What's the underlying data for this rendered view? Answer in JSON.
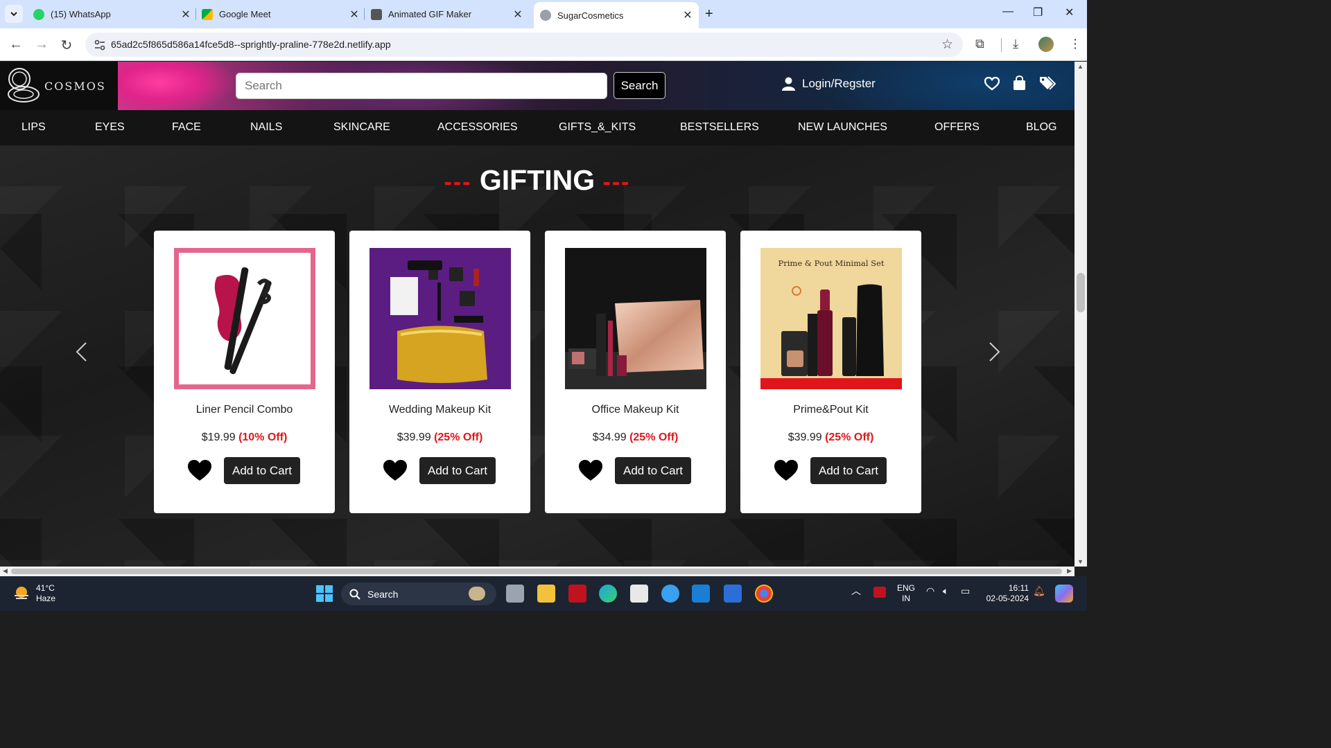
{
  "browser": {
    "tabs": [
      {
        "title": "(15) WhatsApp",
        "active": false
      },
      {
        "title": "Google Meet",
        "active": false
      },
      {
        "title": "Animated GIF Maker",
        "active": false
      },
      {
        "title": "SugarCosmetics",
        "active": true
      }
    ],
    "url": "65ad2c5f865d586a14fce5d8--sprightly-praline-778e2d.netlify.app"
  },
  "site": {
    "logo_text": "COSMOS",
    "search_placeholder": "Search",
    "search_button": "Search",
    "login_label": "Login/Regster",
    "categories": [
      "LIPS",
      "EYES",
      "FACE",
      "NAILS",
      "SKINCARE",
      "ACCESSORIES",
      "GIFTS_&_KITS",
      "BESTSELLERS",
      "NEW LAUNCHES",
      "OFFERS",
      "BLOG"
    ],
    "section_title": "GIFTING",
    "title_dashes": "---",
    "cart_label": "Add to Cart",
    "products": [
      {
        "name": "Liner Pencil Combo",
        "price": "$19.99",
        "discount": "(10% Off)"
      },
      {
        "name": "Wedding Makeup Kit",
        "price": "$39.99",
        "discount": "(25% Off)"
      },
      {
        "name": "Office Makeup Kit",
        "price": "$34.99",
        "discount": "(25% Off)"
      },
      {
        "name": "Prime&Pout Kit",
        "price": "$39.99",
        "discount": "(25% Off)",
        "image_caption": "Prime & Pout Minimal Set"
      }
    ],
    "accent_color": "#e0151b"
  },
  "taskbar": {
    "temperature": "41°C",
    "weather": "Haze",
    "search_label": "Search",
    "lang_line1": "ENG",
    "lang_line2": "IN",
    "time": "16:11",
    "date": "02-05-2024"
  }
}
